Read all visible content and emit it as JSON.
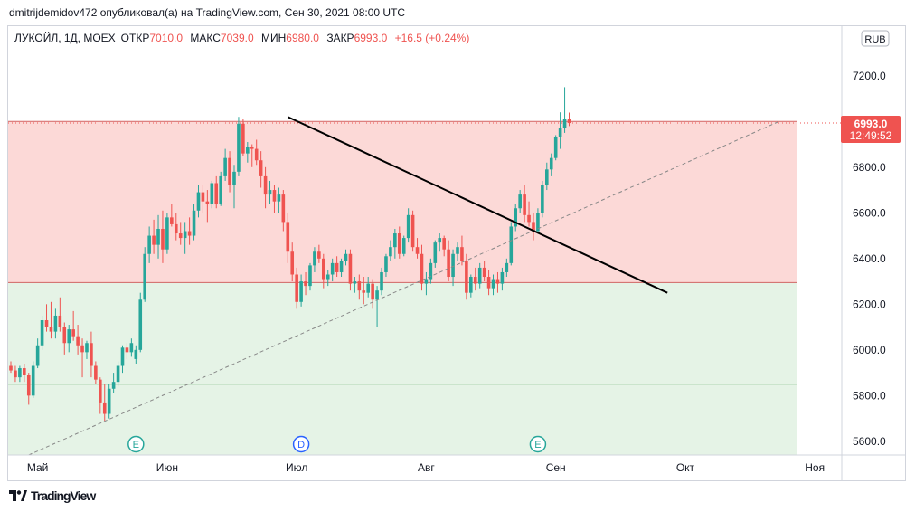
{
  "header": {
    "publisher_line": "dmitrijdemidov472 опубликовал(а) на TradingView.com, Сен 30, 2021 08:00 UTC"
  },
  "legend": {
    "symbol": "ЛУКОЙЛ, 1Д, MOEX",
    "open_label": "ОТКР",
    "open_value": "7010.0",
    "high_label": "МАКС",
    "high_value": "7039.0",
    "low_label": "МИН",
    "low_value": "6980.0",
    "close_label": "ЗАКР",
    "close_value": "6993.0",
    "change": "+16.5 (+0.24%)"
  },
  "currency_button": "RUB",
  "price_tag": {
    "price": "6993.0",
    "countdown": "12:49:52"
  },
  "colors": {
    "up": "#26a69a",
    "down": "#ef5350",
    "zone_red": "#fcd9d7",
    "zone_green": "#e5f3e6",
    "zone_red_line": "#d26464",
    "zone_green_line": "#7cb87c",
    "trendline": "#000000",
    "support_dash": "#888888",
    "event_earnings": "#26a69a",
    "event_dividend": "#2962ff"
  },
  "footer": {
    "brand": "TradingView",
    "logo_icon": "tradingview-logo-icon"
  },
  "chart_data": {
    "type": "candlestick",
    "y_axis": {
      "min": 5540,
      "max": 7310,
      "ticks": [
        5600,
        5800,
        6000,
        6200,
        6400,
        6600,
        6800,
        7000,
        7200
      ],
      "tick_labels": [
        "5600.0",
        "5800.0",
        "6000.0",
        "6200.0",
        "6400.0",
        "6600.0",
        "6800.0",
        "7000.0",
        "7200.0"
      ]
    },
    "x_axis": {
      "labels": [
        "Май",
        "Июн",
        "Июл",
        "Авг",
        "Сен",
        "Окт",
        "Ноя"
      ],
      "label_bar_index": [
        6,
        35,
        64,
        93,
        122,
        151,
        180
      ]
    },
    "zones": [
      {
        "name": "upper",
        "from": 6295,
        "to": 7000
      },
      {
        "name": "lower",
        "from": 5540,
        "to": 6295
      }
    ],
    "horizontal_lines": [
      7000,
      6295,
      5850
    ],
    "trendline": {
      "from": {
        "bar": 62,
        "price": 7020
      },
      "to": {
        "bar": 147,
        "price": 6250
      }
    },
    "support_line": {
      "from": {
        "bar": 4,
        "price": 5540
      },
      "to": {
        "bar": 172,
        "price": 7000
      }
    },
    "last_price_line": 6993,
    "events": [
      {
        "bar": 28,
        "letter": "E",
        "kind": "earnings"
      },
      {
        "bar": 65,
        "letter": "D",
        "kind": "dividend"
      },
      {
        "bar": 118,
        "letter": "E",
        "kind": "earnings"
      }
    ],
    "candles": [
      [
        5930,
        5950,
        5900,
        5910
      ],
      [
        5910,
        5930,
        5860,
        5880
      ],
      [
        5880,
        5930,
        5860,
        5920
      ],
      [
        5920,
        5940,
        5860,
        5890
      ],
      [
        5890,
        5900,
        5760,
        5800
      ],
      [
        5800,
        5950,
        5790,
        5930
      ],
      [
        5930,
        6050,
        5920,
        6020
      ],
      [
        6020,
        6150,
        6000,
        6130
      ],
      [
        6130,
        6200,
        6080,
        6100
      ],
      [
        6100,
        6210,
        6050,
        6080
      ],
      [
        6080,
        6180,
        6050,
        6150
      ],
      [
        6150,
        6230,
        6080,
        6100
      ],
      [
        6100,
        6120,
        5980,
        6030
      ],
      [
        6030,
        6110,
        5990,
        6090
      ],
      [
        6090,
        6170,
        6040,
        6060
      ],
      [
        6060,
        6110,
        5980,
        6020
      ],
      [
        6020,
        6050,
        5880,
        5990
      ],
      [
        5990,
        6040,
        5960,
        6030
      ],
      [
        6030,
        6080,
        5880,
        5930
      ],
      [
        5930,
        5950,
        5850,
        5870
      ],
      [
        5870,
        5880,
        5720,
        5770
      ],
      [
        5770,
        5850,
        5690,
        5720
      ],
      [
        5720,
        5850,
        5700,
        5830
      ],
      [
        5830,
        5900,
        5810,
        5860
      ],
      [
        5860,
        5950,
        5840,
        5930
      ],
      [
        5930,
        6020,
        5900,
        6010
      ],
      [
        6010,
        6030,
        5960,
        5990
      ],
      [
        5990,
        6050,
        5970,
        6030
      ],
      [
        5960,
        6020,
        5940,
        6000
      ],
      [
        6000,
        6250,
        5990,
        6220
      ],
      [
        6220,
        6450,
        6210,
        6420
      ],
      [
        6420,
        6540,
        6380,
        6500
      ],
      [
        6500,
        6570,
        6420,
        6460
      ],
      [
        6460,
        6590,
        6400,
        6530
      ],
      [
        6530,
        6610,
        6380,
        6440
      ],
      [
        6440,
        6600,
        6420,
        6580
      ],
      [
        6580,
        6640,
        6540,
        6550
      ],
      [
        6550,
        6600,
        6480,
        6510
      ],
      [
        6510,
        6560,
        6460,
        6490
      ],
      [
        6490,
        6560,
        6420,
        6520
      ],
      [
        6520,
        6580,
        6460,
        6500
      ],
      [
        6500,
        6640,
        6480,
        6610
      ],
      [
        6610,
        6720,
        6580,
        6690
      ],
      [
        6690,
        6720,
        6600,
        6650
      ],
      [
        6650,
        6700,
        6560,
        6640
      ],
      [
        6640,
        6740,
        6620,
        6730
      ],
      [
        6730,
        6760,
        6620,
        6640
      ],
      [
        6640,
        6780,
        6630,
        6760
      ],
      [
        6760,
        6880,
        6740,
        6840
      ],
      [
        6840,
        6870,
        6690,
        6720
      ],
      [
        6720,
        6810,
        6620,
        6780
      ],
      [
        6780,
        7020,
        6760,
        6990
      ],
      [
        6990,
        7010,
        6850,
        6860
      ],
      [
        6860,
        6910,
        6820,
        6890
      ],
      [
        6890,
        6900,
        6800,
        6880
      ],
      [
        6880,
        6920,
        6810,
        6830
      ],
      [
        6830,
        6870,
        6710,
        6760
      ],
      [
        6760,
        6800,
        6620,
        6680
      ],
      [
        6680,
        6740,
        6640,
        6700
      ],
      [
        6700,
        6720,
        6600,
        6650
      ],
      [
        6650,
        6710,
        6600,
        6680
      ],
      [
        6680,
        6700,
        6520,
        6560
      ],
      [
        6560,
        6600,
        6380,
        6430
      ],
      [
        6430,
        6470,
        6300,
        6330
      ],
      [
        6330,
        6360,
        6180,
        6210
      ],
      [
        6210,
        6330,
        6190,
        6300
      ],
      [
        6300,
        6340,
        6240,
        6280
      ],
      [
        6280,
        6380,
        6260,
        6370
      ],
      [
        6370,
        6450,
        6340,
        6430
      ],
      [
        6430,
        6460,
        6380,
        6400
      ],
      [
        6400,
        6420,
        6270,
        6310
      ],
      [
        6310,
        6350,
        6280,
        6330
      ],
      [
        6330,
        6400,
        6300,
        6380
      ],
      [
        6380,
        6410,
        6320,
        6340
      ],
      [
        6340,
        6400,
        6320,
        6390
      ],
      [
        6390,
        6440,
        6370,
        6420
      ],
      [
        6420,
        6440,
        6260,
        6290
      ],
      [
        6290,
        6320,
        6250,
        6300
      ],
      [
        6300,
        6330,
        6220,
        6260
      ],
      [
        6260,
        6320,
        6200,
        6250
      ],
      [
        6250,
        6320,
        6230,
        6290
      ],
      [
        6290,
        6310,
        6180,
        6220
      ],
      [
        6220,
        6280,
        6100,
        6260
      ],
      [
        6260,
        6360,
        6240,
        6340
      ],
      [
        6340,
        6420,
        6320,
        6410
      ],
      [
        6410,
        6480,
        6390,
        6450
      ],
      [
        6450,
        6530,
        6400,
        6510
      ],
      [
        6510,
        6540,
        6400,
        6420
      ],
      [
        6420,
        6500,
        6410,
        6490
      ],
      [
        6490,
        6620,
        6470,
        6590
      ],
      [
        6590,
        6610,
        6430,
        6450
      ],
      [
        6450,
        6490,
        6400,
        6420
      ],
      [
        6420,
        6460,
        6260,
        6290
      ],
      [
        6290,
        6340,
        6240,
        6310
      ],
      [
        6310,
        6400,
        6290,
        6380
      ],
      [
        6380,
        6480,
        6360,
        6470
      ],
      [
        6470,
        6510,
        6430,
        6490
      ],
      [
        6490,
        6500,
        6410,
        6440
      ],
      [
        6440,
        6480,
        6300,
        6320
      ],
      [
        6320,
        6440,
        6280,
        6420
      ],
      [
        6420,
        6470,
        6390,
        6450
      ],
      [
        6450,
        6500,
        6370,
        6390
      ],
      [
        6390,
        6420,
        6220,
        6250
      ],
      [
        6250,
        6330,
        6230,
        6320
      ],
      [
        6320,
        6360,
        6260,
        6290
      ],
      [
        6290,
        6380,
        6270,
        6360
      ],
      [
        6360,
        6390,
        6300,
        6320
      ],
      [
        6320,
        6350,
        6240,
        6270
      ],
      [
        6270,
        6330,
        6240,
        6310
      ],
      [
        6310,
        6340,
        6250,
        6290
      ],
      [
        6290,
        6360,
        6260,
        6340
      ],
      [
        6340,
        6400,
        6320,
        6380
      ],
      [
        6380,
        6560,
        6370,
        6540
      ],
      [
        6540,
        6640,
        6520,
        6620
      ],
      [
        6620,
        6700,
        6600,
        6680
      ],
      [
        6680,
        6720,
        6560,
        6590
      ],
      [
        6590,
        6650,
        6540,
        6560
      ],
      [
        6560,
        6600,
        6480,
        6520
      ],
      [
        6520,
        6620,
        6510,
        6600
      ],
      [
        6600,
        6740,
        6580,
        6720
      ],
      [
        6720,
        6820,
        6700,
        6790
      ],
      [
        6790,
        6860,
        6760,
        6840
      ],
      [
        6840,
        6940,
        6830,
        6930
      ],
      [
        6930,
        7040,
        6880,
        6970
      ],
      [
        6970,
        7150,
        6950,
        7010
      ],
      [
        7010,
        7039,
        6980,
        6993
      ]
    ]
  }
}
